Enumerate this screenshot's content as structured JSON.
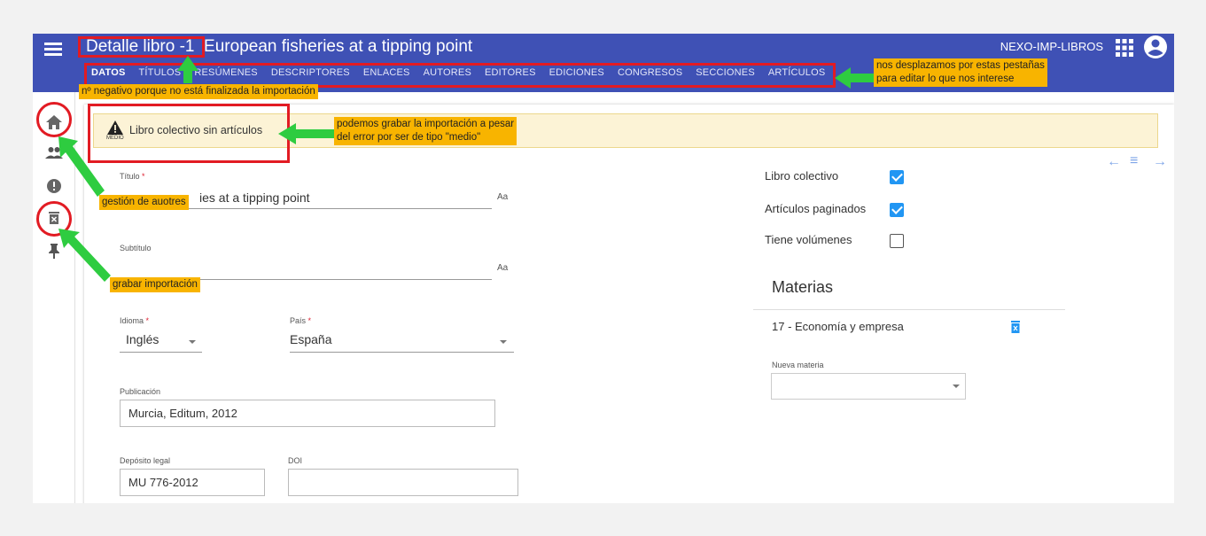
{
  "header": {
    "title": "Detalle libro -1  European fisheries at a tipping point",
    "app_name": "NEXO-IMP-LIBROS",
    "menu_icon": "hamburger-menu-icon",
    "apps_icon": "apps-grid-icon",
    "user_icon": "account-circle-icon",
    "bg_color": "#3f51b5"
  },
  "tabs": [
    {
      "label": "DATOS",
      "active": true
    },
    {
      "label": "TÍTULOS",
      "active": false
    },
    {
      "label": "RESÚMENES",
      "active": false
    },
    {
      "label": "DESCRIPTORES",
      "active": false
    },
    {
      "label": "ENLACES",
      "active": false
    },
    {
      "label": "AUTORES",
      "active": false
    },
    {
      "label": "EDITORES",
      "active": false
    },
    {
      "label": "EDICIONES",
      "active": false
    },
    {
      "label": "CONGRESOS",
      "active": false
    },
    {
      "label": "SECCIONES",
      "active": false
    },
    {
      "label": "ARTÍCULOS",
      "active": false
    }
  ],
  "sidebar": {
    "items": [
      "home-icon",
      "people-icon",
      "alert-icon",
      "delete-box-icon",
      "pin-icon"
    ]
  },
  "warning": {
    "text": "Libro colectivo sin artículos",
    "level": "MEDIO"
  },
  "form": {
    "titulo": {
      "label": "Título",
      "required_mark": "*",
      "value": "ies at a tipping point"
    },
    "subtitulo": {
      "label": "Subtítulo",
      "value": ""
    },
    "idioma": {
      "label": "Idioma",
      "required_mark": "*",
      "value": "Inglés"
    },
    "pais": {
      "label": "País",
      "required_mark": "*",
      "value": "España"
    },
    "publicacion": {
      "label": "Publicación",
      "value": "Murcia, Editum, 2012"
    },
    "deposito": {
      "label": "Depósito legal",
      "value": "MU 776-2012"
    },
    "doi": {
      "label": "DOI",
      "value": ""
    },
    "font_icon": "Aa"
  },
  "checks": [
    {
      "label": "Libro colectivo",
      "checked": true
    },
    {
      "label": "Artículos paginados",
      "checked": true
    },
    {
      "label": "Tiene volúmenes",
      "checked": false
    }
  ],
  "materias": {
    "title": "Materias",
    "items": [
      "17 - Economía y empresa"
    ],
    "nueva_label": "Nueva materia"
  },
  "annotations": {
    "negativo": "nº negativo porque no está finalizada la importación",
    "pestanas_1": "nos desplazamos por estas pestañas",
    "pestanas_2": "para editar lo que nos interese",
    "grabar_1": "podemos grabar la importación a pesar",
    "grabar_2": "del error por ser de tipo \"medio\"",
    "autores": "gestión de auotres",
    "importacion": "grabar importación",
    "note_color": "#f8b400",
    "mark_color": "#e21b23",
    "arrow_color": "#2ecc40"
  }
}
